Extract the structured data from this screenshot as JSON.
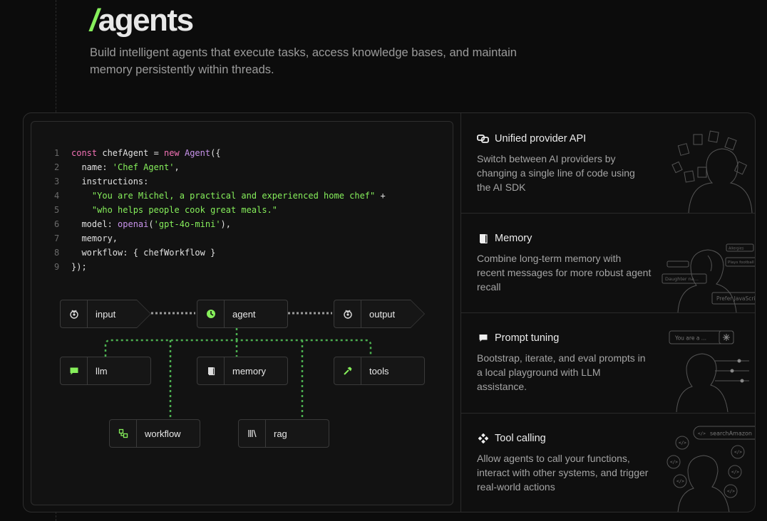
{
  "header": {
    "slash": "/",
    "title": "agents",
    "subtitle": "Build intelligent agents that execute tasks, access knowledge bases, and maintain memory persistently within threads."
  },
  "code": {
    "line_numbers": [
      "1",
      "2",
      "3",
      "4",
      "5",
      "6",
      "7",
      "8",
      "9"
    ],
    "l1": {
      "a": "const",
      "b": " chefAgent = ",
      "c": "new",
      "d": " ",
      "e": "Agent",
      "f": "({"
    },
    "l2": {
      "a": "  name: ",
      "b": "'Chef Agent'",
      "c": ","
    },
    "l3": {
      "a": "  instructions:"
    },
    "l4": {
      "a": "    ",
      "b": "\"You are Michel, a practical and experienced home chef\"",
      "c": " +"
    },
    "l5": {
      "a": "    ",
      "b": "\"who helps people cook great meals.\""
    },
    "l6": {
      "a": "  model: ",
      "b": "openai",
      "c": "(",
      "d": "'gpt-4o-mini'",
      "e": "),"
    },
    "l7": {
      "a": "  memory,"
    },
    "l8": {
      "a": "  workflow: { chefWorkflow }"
    },
    "l9": {
      "a": "});"
    }
  },
  "diagram": {
    "input": "input",
    "agent": "agent",
    "output": "output",
    "llm": "llm",
    "memory": "memory",
    "tools": "tools",
    "workflow": "workflow",
    "rag": "rag"
  },
  "features": [
    {
      "title": "Unified provider API",
      "description": "Switch between AI providers by changing a single line of code using the AI SDK",
      "icon": "link-icon"
    },
    {
      "title": "Memory",
      "description": "Combine long-term memory with recent messages for more robust agent recall",
      "icon": "book-icon"
    },
    {
      "title": "Prompt tuning",
      "description": "Bootstrap, iterate, and eval prompts in a local playground with LLM assistance.",
      "icon": "chat-icon"
    },
    {
      "title": "Tool calling",
      "description": "Allow agents to call your functions, interact with other systems, and trigger real-world actions",
      "icon": "tools-icon"
    }
  ],
  "illustrations": {
    "memory_tags": [
      "Daughter na...",
      "Prefer JavaScript",
      "Plays football",
      "Allergies"
    ],
    "prompt_input": "You are a ...",
    "tool_tag": "searchAmazon"
  },
  "colors": {
    "accent": "#86ef5b",
    "keyword": "#f472b6",
    "function": "#c792ea",
    "background": "#0c0c0c"
  }
}
